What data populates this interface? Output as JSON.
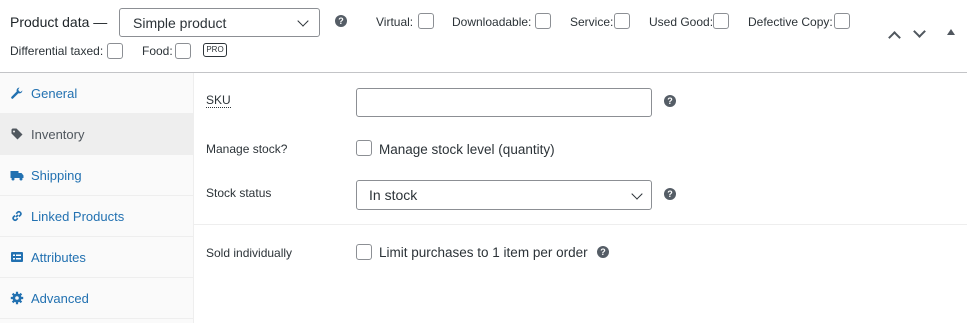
{
  "header": {
    "title": "Product data —",
    "product_type": "Simple product",
    "options": [
      {
        "label": "Virtual:",
        "checked": false
      },
      {
        "label": "Downloadable:",
        "checked": false
      },
      {
        "label": "Service:",
        "checked": false
      },
      {
        "label": "Used Good:",
        "checked": false
      },
      {
        "label": "Defective Copy:",
        "checked": false
      },
      {
        "label": "Differential taxed:",
        "checked": false
      },
      {
        "label": "Food:",
        "checked": false
      }
    ],
    "pro_badge": "PRO",
    "help_glyph": "?"
  },
  "sidebar": {
    "items": [
      {
        "label": "General",
        "icon": "wrench-icon",
        "active": false
      },
      {
        "label": "Inventory",
        "icon": "tag-icon",
        "active": true
      },
      {
        "label": "Shipping",
        "icon": "truck-icon",
        "active": false
      },
      {
        "label": "Linked Products",
        "icon": "link-icon",
        "active": false
      },
      {
        "label": "Attributes",
        "icon": "list-icon",
        "active": false
      },
      {
        "label": "Advanced",
        "icon": "gear-icon",
        "active": false
      }
    ]
  },
  "inventory": {
    "sku_label": "SKU",
    "sku_value": "",
    "manage_stock_label": "Manage stock?",
    "manage_stock_checkbox_label": "Manage stock level (quantity)",
    "manage_stock_checked": false,
    "stock_status_label": "Stock status",
    "stock_status_value": "In stock",
    "sold_individually_label": "Sold individually",
    "sold_individually_checkbox_label": "Limit purchases to 1 item per order",
    "sold_individually_checked": false
  },
  "colors": {
    "link": "#2271b1",
    "border": "#8c8f94",
    "active_tab_bg": "#eeeeee"
  }
}
